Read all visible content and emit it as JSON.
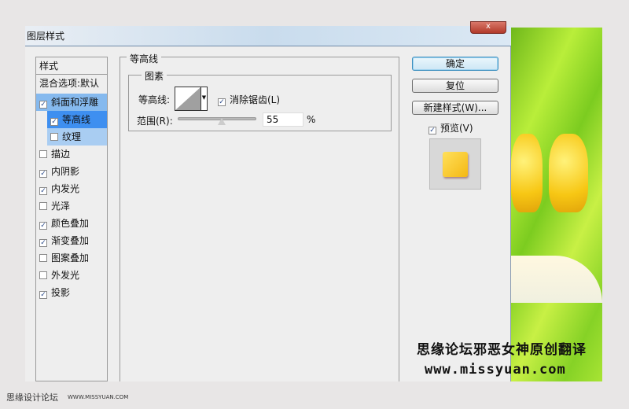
{
  "dialog": {
    "title": "图层样式",
    "close_label": "x"
  },
  "styles": {
    "header": "样式",
    "blending": "混合选项:默认",
    "items": [
      {
        "label": "斜面和浮雕",
        "checked": true
      },
      {
        "label": "等高线",
        "checked": true
      },
      {
        "label": "纹理",
        "checked": false
      },
      {
        "label": "描边",
        "checked": false
      },
      {
        "label": "内阴影",
        "checked": true
      },
      {
        "label": "内发光",
        "checked": true
      },
      {
        "label": "光泽",
        "checked": false
      },
      {
        "label": "颜色叠加",
        "checked": true
      },
      {
        "label": "渐变叠加",
        "checked": true
      },
      {
        "label": "图案叠加",
        "checked": false
      },
      {
        "label": "外发光",
        "checked": false
      },
      {
        "label": "投影",
        "checked": true
      }
    ]
  },
  "contour": {
    "group_title": "等高线",
    "sub_title": "图素",
    "contour_label": "等高线:",
    "antialias_label": "消除锯齿(L)",
    "antialias_checked": true,
    "range_label": "范围(R):",
    "range_value": "55",
    "range_percent": 55,
    "range_unit": "%"
  },
  "buttons": {
    "ok": "确定",
    "reset": "复位",
    "new_style": "新建样式(W)...",
    "preview": "预览(V)",
    "preview_checked": true
  },
  "watermark": {
    "line1": "思缘论坛邪恶女神原创翻译",
    "line2": "www.missyuan.com"
  },
  "footer": {
    "site": "思缘设计论坛",
    "url": "WWW.MISSYUAN.COM"
  }
}
